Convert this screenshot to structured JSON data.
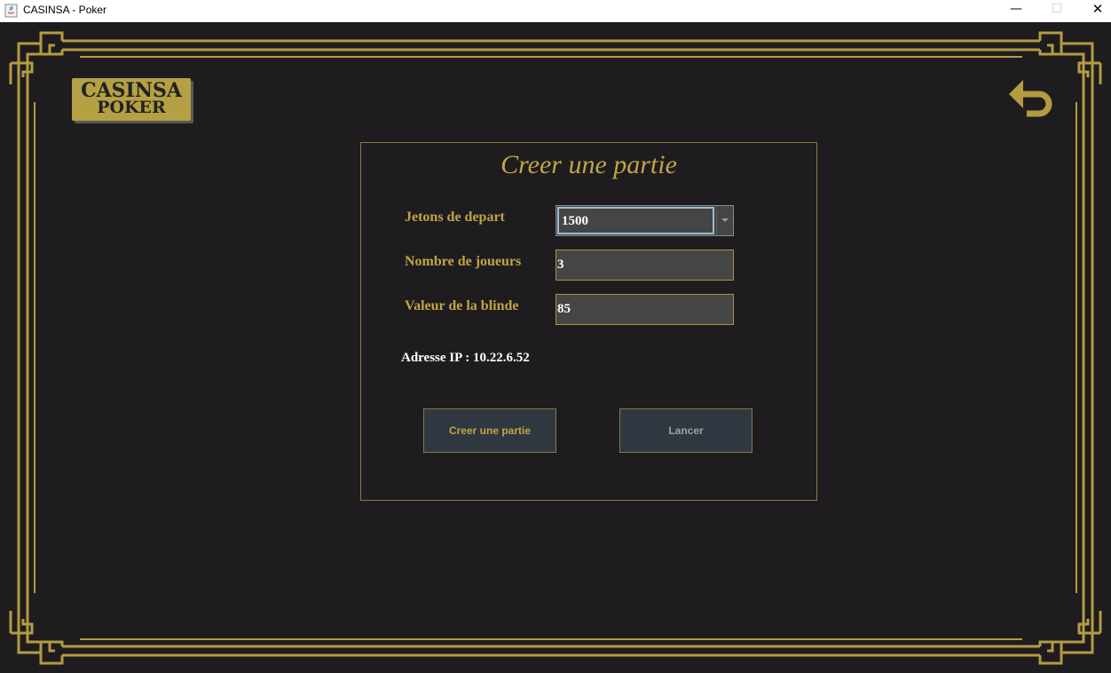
{
  "window": {
    "title": "CASINSA - Poker",
    "minimize_glyph": "—",
    "maximize_glyph": "☐",
    "close_glyph": "✕"
  },
  "logo": {
    "line1": "CASINSA",
    "line2": "POKER"
  },
  "back_icon": "undo-arrow-icon",
  "panel": {
    "title": "Creer une partie",
    "fields": {
      "jetons_label": "Jetons de depart",
      "jetons_value": "1500",
      "joueurs_label": "Nombre de joueurs",
      "joueurs_value": "3",
      "blinde_label": "Valeur de la blinde",
      "blinde_value": "85"
    },
    "ip_text": "Adresse IP : 10.22.6.52",
    "buttons": {
      "create_label": "Creer une partie",
      "launch_label": "Lancer"
    }
  },
  "colors": {
    "background": "#1f1c1f",
    "gold": "#bfa645",
    "frame_gold": "#b39c40",
    "input_bg": "#454545",
    "button_bg": "#2f3741"
  }
}
